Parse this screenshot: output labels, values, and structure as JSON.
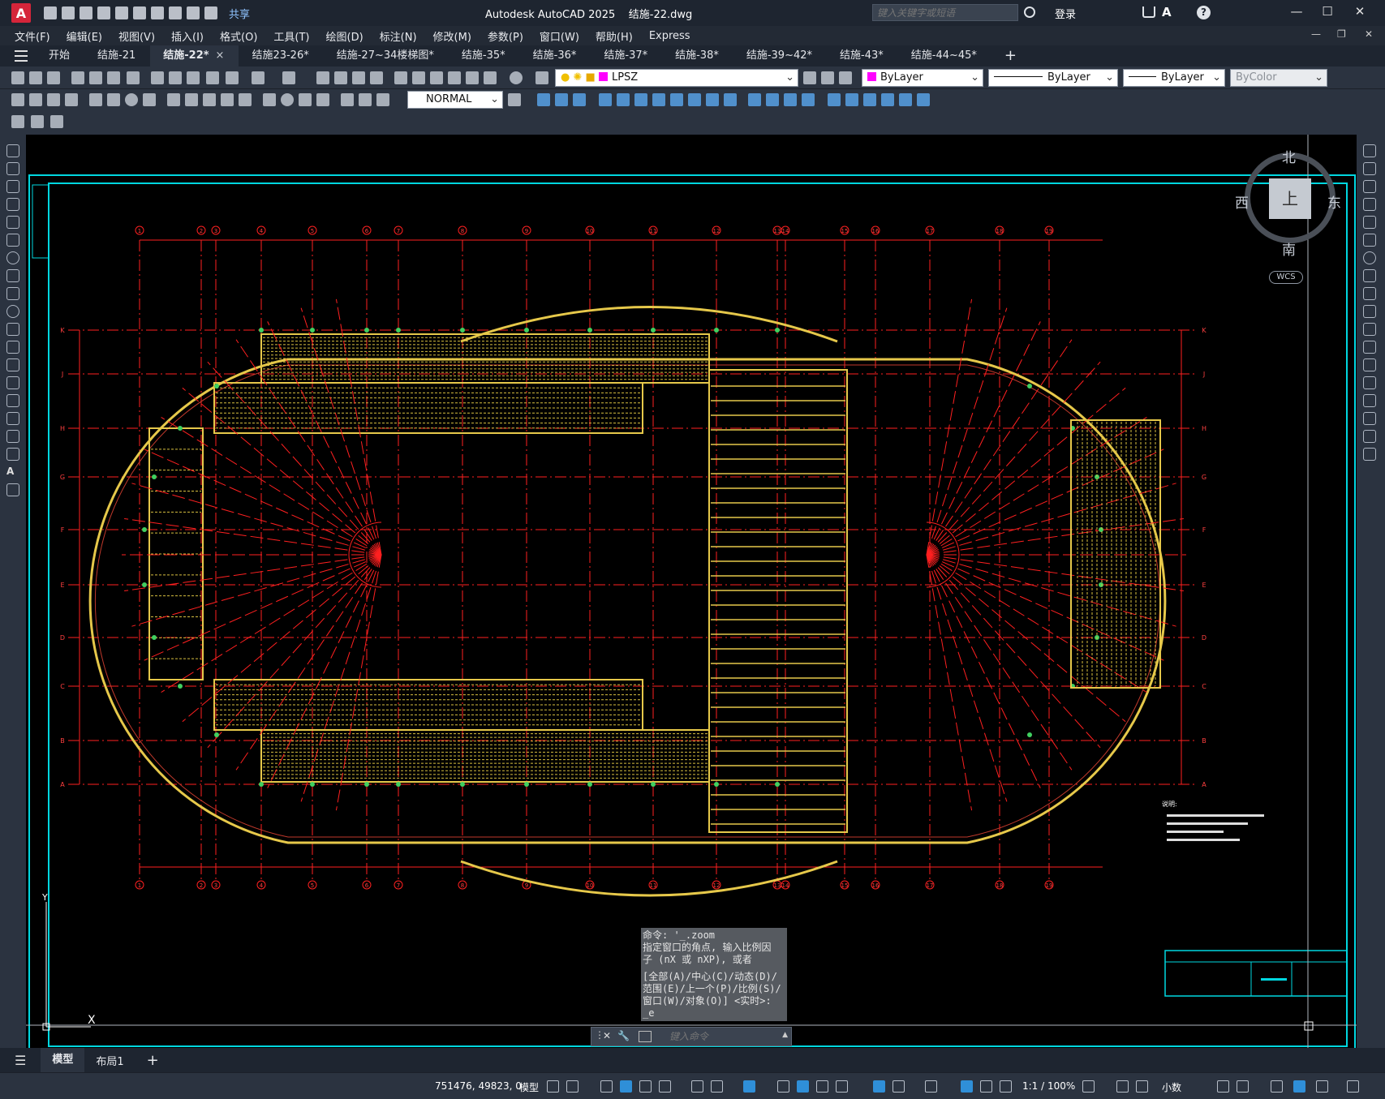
{
  "app": {
    "logo_letter": "A",
    "title": "Autodesk AutoCAD 2025    结施-22.dwg",
    "share": "共享",
    "search_placeholder": "键入关键字或短语",
    "login": "登录"
  },
  "menu": [
    "文件(F)",
    "编辑(E)",
    "视图(V)",
    "插入(I)",
    "格式(O)",
    "工具(T)",
    "绘图(D)",
    "标注(N)",
    "修改(M)",
    "参数(P)",
    "窗口(W)",
    "帮助(H)",
    "Express"
  ],
  "tabs": [
    {
      "label": "开始",
      "active": false
    },
    {
      "label": "结施-21",
      "active": false
    },
    {
      "label": "结施-22*",
      "active": true
    },
    {
      "label": "结施23-26*",
      "active": false
    },
    {
      "label": "结施-27~34楼梯图*",
      "active": false
    },
    {
      "label": "结施-35*",
      "active": false
    },
    {
      "label": "结施-36*",
      "active": false
    },
    {
      "label": "结施-37*",
      "active": false
    },
    {
      "label": "结施-38*",
      "active": false
    },
    {
      "label": "结施-39~42*",
      "active": false
    },
    {
      "label": "结施-43*",
      "active": false
    },
    {
      "label": "结施-44~45*",
      "active": false
    }
  ],
  "tab_close": "×",
  "tab_add": "+",
  "toolbar": {
    "layer": "LPSZ",
    "color": "ByLayer",
    "linetype": "ByLayer",
    "lineweight": "ByLayer",
    "plotstyle": "ByColor",
    "dimstyle": "NORMAL",
    "layer_color": "#ff00ff"
  },
  "viewcube": {
    "north": "北",
    "south": "南",
    "east": "东",
    "west": "西",
    "top": "上",
    "wcs": "WCS"
  },
  "drawing": {
    "grid_top": [
      "1",
      "2",
      "3",
      "4",
      "5",
      "6",
      "7",
      "8",
      "9",
      "10",
      "11",
      "12",
      "13",
      "14",
      "15",
      "16",
      "17",
      "18",
      "19"
    ],
    "grid_left": [
      "K",
      "J",
      "H",
      "G",
      "F",
      "E",
      "D",
      "C",
      "B",
      "A"
    ],
    "notes_title": "说明:"
  },
  "command": {
    "history": [
      "命令: '_.zoom",
      "指定窗口的角点, 输入比例因",
      "子 (nX 或 nXP), 或者",
      "[全部(A)/中心(C)/动态(D)/",
      "范围(E)/上一个(P)/比例(S)/",
      "窗口(W)/对象(O)] <实时>:",
      "_e"
    ],
    "placeholder": "键入命令"
  },
  "layout_tabs": [
    "模型",
    "布局1"
  ],
  "layout_add": "+",
  "status": {
    "coords": "751476, 49823, 0",
    "model": "模型",
    "scale": "1:1 / 100%",
    "units": "小数"
  }
}
